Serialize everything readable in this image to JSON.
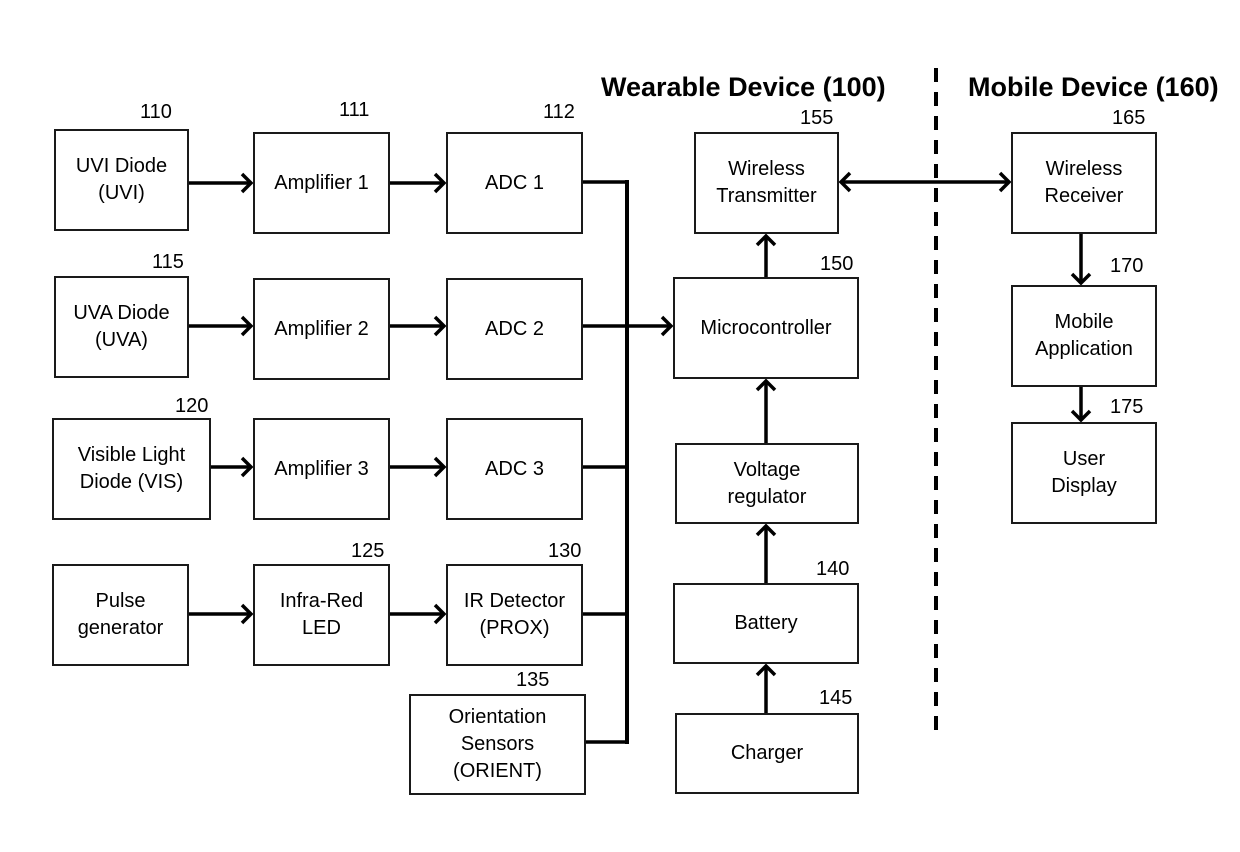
{
  "diagram": {
    "sections": [
      {
        "id": "wearable",
        "title": "Wearable Device (100)"
      },
      {
        "id": "mobile",
        "title": "Mobile Device (160)"
      }
    ],
    "blocks": [
      {
        "id": "uvi",
        "label": "UVI Diode\n(UVI)",
        "ref": "110"
      },
      {
        "id": "amp1",
        "label": "Amplifier 1",
        "ref": "111"
      },
      {
        "id": "adc1",
        "label": "ADC 1",
        "ref": "112"
      },
      {
        "id": "uva",
        "label": "UVA Diode\n(UVA)",
        "ref": "115"
      },
      {
        "id": "amp2",
        "label": "Amplifier 2",
        "ref": ""
      },
      {
        "id": "adc2",
        "label": "ADC 2",
        "ref": ""
      },
      {
        "id": "vis",
        "label": "Visible Light\nDiode (VIS)",
        "ref": "120"
      },
      {
        "id": "amp3",
        "label": "Amplifier 3",
        "ref": ""
      },
      {
        "id": "adc3",
        "label": "ADC 3",
        "ref": ""
      },
      {
        "id": "pulse",
        "label": "Pulse\ngenerator",
        "ref": ""
      },
      {
        "id": "irled",
        "label": "Infra-Red\nLED",
        "ref": "125"
      },
      {
        "id": "irdet",
        "label": "IR Detector\n(PROX)",
        "ref": "130"
      },
      {
        "id": "orient",
        "label": "Orientation\nSensors\n(ORIENT)",
        "ref": "135"
      },
      {
        "id": "tx",
        "label": "Wireless\nTransmitter",
        "ref": "155"
      },
      {
        "id": "mcu",
        "label": "Microcontroller",
        "ref": "150"
      },
      {
        "id": "vreg",
        "label": "Voltage\nregulator",
        "ref": ""
      },
      {
        "id": "battery",
        "label": "Battery",
        "ref": "140"
      },
      {
        "id": "charger",
        "label": "Charger",
        "ref": "145"
      },
      {
        "id": "rx",
        "label": "Wireless\nReceiver",
        "ref": "165"
      },
      {
        "id": "app",
        "label": "Mobile\nApplication",
        "ref": "170"
      },
      {
        "id": "display",
        "label": "User\nDisplay",
        "ref": "175"
      }
    ],
    "connections": [
      {
        "from": "uvi",
        "to": "amp1",
        "type": "arrow"
      },
      {
        "from": "amp1",
        "to": "adc1",
        "type": "arrow"
      },
      {
        "from": "uva",
        "to": "amp2",
        "type": "arrow"
      },
      {
        "from": "amp2",
        "to": "adc2",
        "type": "arrow"
      },
      {
        "from": "vis",
        "to": "amp3",
        "type": "arrow"
      },
      {
        "from": "amp3",
        "to": "adc3",
        "type": "arrow"
      },
      {
        "from": "pulse",
        "to": "irled",
        "type": "arrow"
      },
      {
        "from": "irled",
        "to": "irdet",
        "type": "arrow"
      },
      {
        "from": [
          "adc1",
          "adc2",
          "adc3",
          "irdet",
          "orient"
        ],
        "to": "mcu",
        "type": "bus-arrow"
      },
      {
        "from": "mcu",
        "to": "tx",
        "type": "arrow"
      },
      {
        "from": "vreg",
        "to": "mcu",
        "type": "arrow"
      },
      {
        "from": "battery",
        "to": "vreg",
        "type": "arrow"
      },
      {
        "from": "charger",
        "to": "battery",
        "type": "arrow"
      },
      {
        "from": "tx",
        "to": "rx",
        "type": "bidirectional"
      },
      {
        "from": "rx",
        "to": "app",
        "type": "arrow"
      },
      {
        "from": "app",
        "to": "display",
        "type": "arrow"
      }
    ],
    "separator": {
      "style": "dashed",
      "between": [
        "wearable",
        "mobile"
      ]
    }
  }
}
